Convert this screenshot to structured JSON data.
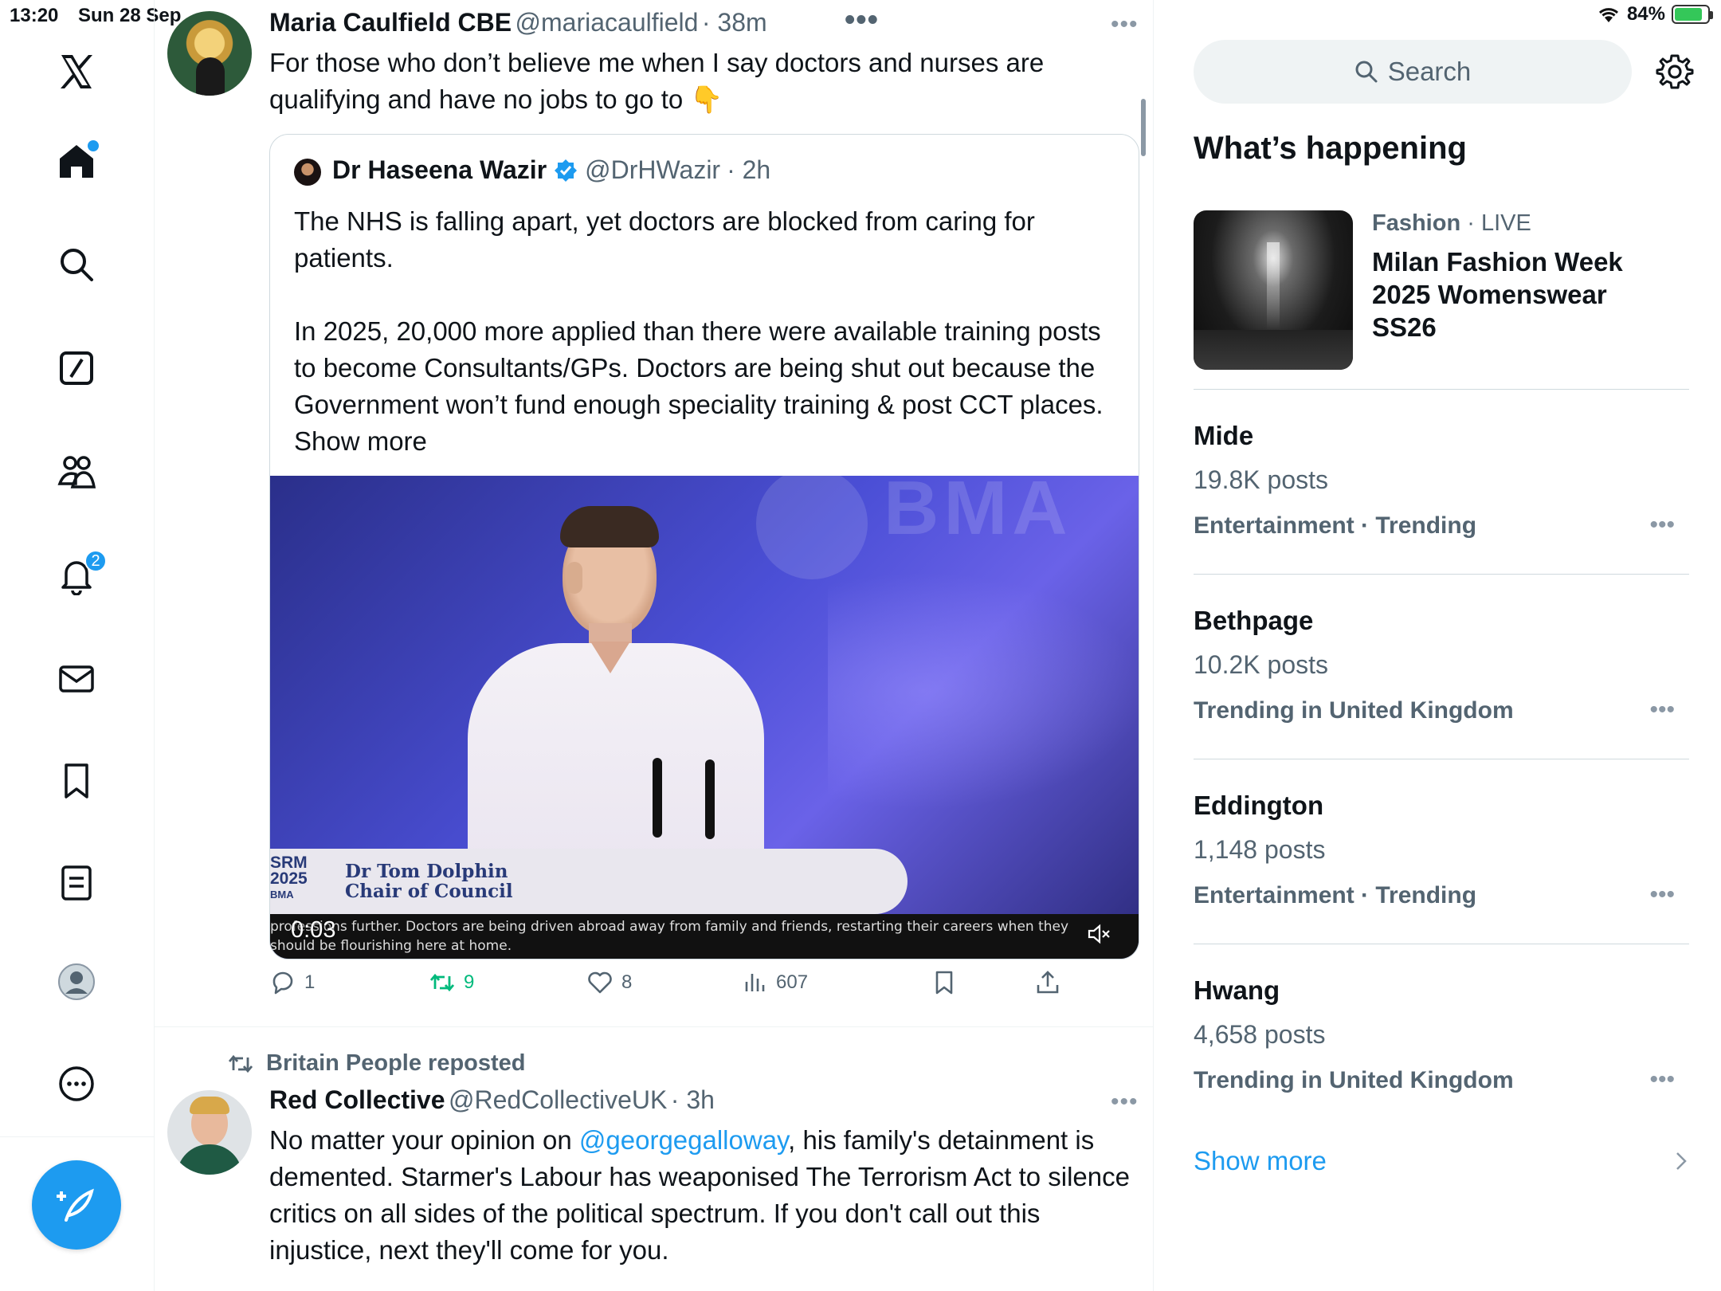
{
  "status_bar": {
    "time": "13:20",
    "date": "Sun 28 Sep",
    "battery": "84%"
  },
  "nav": {
    "notification_count": "2"
  },
  "tweet1": {
    "name": "Maria Caulfield CBE",
    "handle": "@mariacaulfield",
    "time": "· 38m",
    "text": "For those who don’t believe me when I say doctors and nurses are qualifying and have no jobs to go to 👇",
    "quote": {
      "name": "Dr Haseena Wazir",
      "handle": "@DrHWazir",
      "time": "· 2h",
      "para1": "The NHS is falling apart, yet doctors are blocked from caring for patients.",
      "para2": "In 2025, 20,000 more applied than there were available training posts to become Consultants/GPs. Doctors are being shut out because the Government won’t fund enough speciality training & post CCT places.",
      "show_more": "Show more",
      "video": {
        "backdrop_text": "BMA",
        "lower_third_logo_1": "SRM",
        "lower_third_logo_2": "2025",
        "lower_third_logo_3": "BMA",
        "speaker_name": "Dr Tom Dolphin",
        "speaker_title": "Chair of Council",
        "caption": "professions further.  Doctors are being driven abroad away from family and friends, restarting their careers when they should be flourishing here at home.",
        "duration": "0:03"
      }
    },
    "stats": {
      "replies": "1",
      "reposts": "9",
      "likes": "8",
      "views": "607"
    }
  },
  "tweet2": {
    "repost_label": "Britain People reposted",
    "name": "Red Collective",
    "handle": "@RedCollectiveUK",
    "time": "· 3h",
    "text_before": "No matter your opinion on ",
    "mention": "@georgegalloway",
    "text_after": ", his family's detainment is demented. Starmer's Labour has weaponised The Terrorism Act to silence critics on all sides of the political spectrum. If you don't call out this injustice, next they'll come for you."
  },
  "sidebar": {
    "search_placeholder": "Search",
    "section_title": "What’s happening",
    "featured": {
      "category": "Fashion",
      "live": "· LIVE",
      "title": "Milan Fashion Week 2025 Womenswear SS26"
    },
    "trends": [
      {
        "name": "Mide",
        "count": "19.8K posts",
        "meta": "Entertainment · Trending"
      },
      {
        "name": "Bethpage",
        "count": "10.2K posts",
        "meta": "Trending in United Kingdom"
      },
      {
        "name": "Eddington",
        "count": "1,148 posts",
        "meta": "Entertainment · Trending"
      },
      {
        "name": "Hwang",
        "count": "4,658 posts",
        "meta": "Trending in United Kingdom"
      }
    ],
    "show_more": "Show more"
  },
  "colors": {
    "accent": "#1d9bf0",
    "repost_green": "#00ba7c",
    "secondary_text": "#536471"
  }
}
